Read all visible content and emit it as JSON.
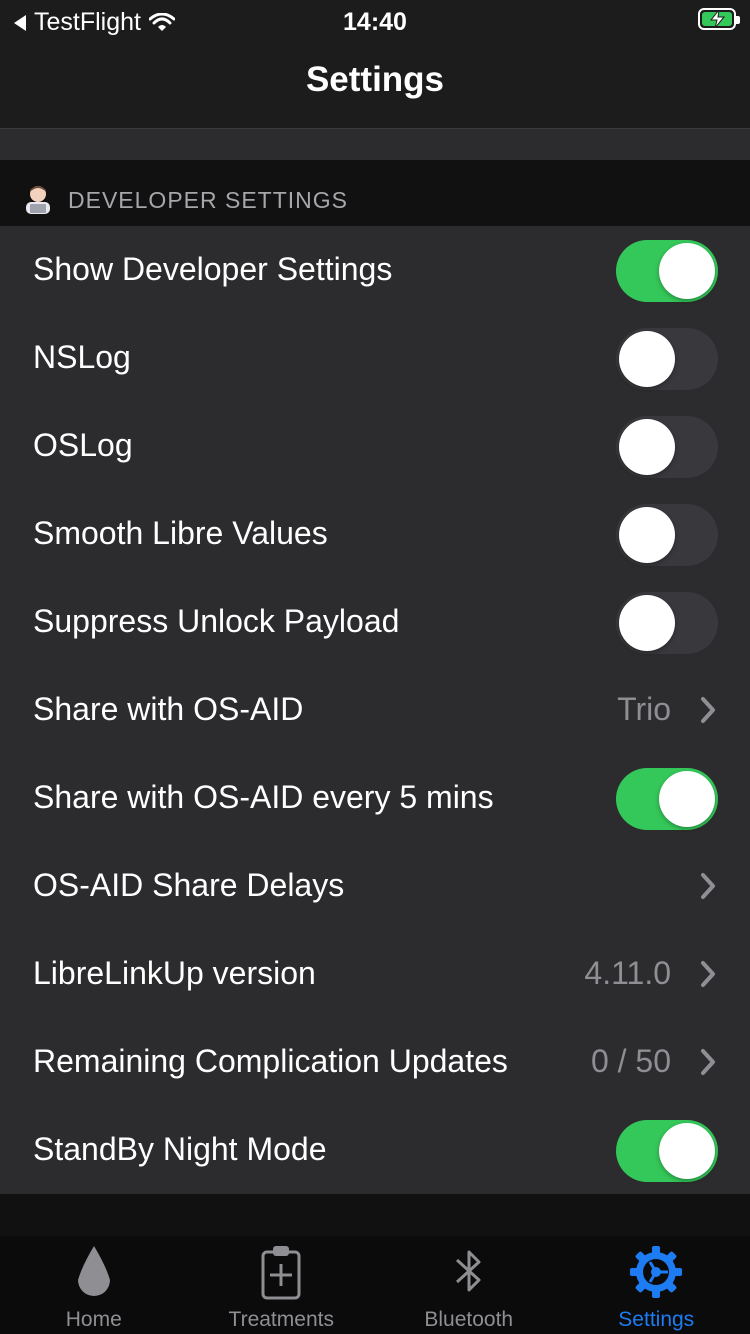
{
  "status_bar": {
    "back_app": "TestFlight",
    "time": "14:40"
  },
  "nav": {
    "title": "Settings"
  },
  "section": {
    "title": "DEVELOPER SETTINGS",
    "icon": "developer-emoji-icon"
  },
  "rows": [
    {
      "label": "Show Developer Settings",
      "type": "toggle",
      "on": true
    },
    {
      "label": "NSLog",
      "type": "toggle",
      "on": false
    },
    {
      "label": "OSLog",
      "type": "toggle",
      "on": false
    },
    {
      "label": "Smooth Libre Values",
      "type": "toggle",
      "on": false
    },
    {
      "label": "Suppress Unlock Payload",
      "type": "toggle",
      "on": false
    },
    {
      "label": "Share with OS-AID",
      "type": "disclosure",
      "value": "Trio"
    },
    {
      "label": "Share with OS-AID every 5 mins",
      "type": "toggle",
      "on": true
    },
    {
      "label": "OS-AID Share Delays",
      "type": "disclosure",
      "value": ""
    },
    {
      "label": "LibreLinkUp version",
      "type": "disclosure",
      "value": "4.11.0"
    },
    {
      "label": "Remaining Complication Updates",
      "type": "disclosure",
      "value": "0 / 50"
    },
    {
      "label": "StandBy Night Mode",
      "type": "toggle",
      "on": true
    }
  ],
  "tabs": [
    {
      "label": "Home",
      "icon": "drop-icon",
      "active": false
    },
    {
      "label": "Treatments",
      "icon": "clipboard-plus-icon",
      "active": false
    },
    {
      "label": "Bluetooth",
      "icon": "bluetooth-icon",
      "active": false
    },
    {
      "label": "Settings",
      "icon": "gear-icon",
      "active": true
    }
  ],
  "colors": {
    "accent": "#1d7cf2",
    "toggle_on": "#34c759",
    "toggle_off": "#39393d",
    "cell_bg": "#2c2c2e",
    "background": "#111111"
  }
}
